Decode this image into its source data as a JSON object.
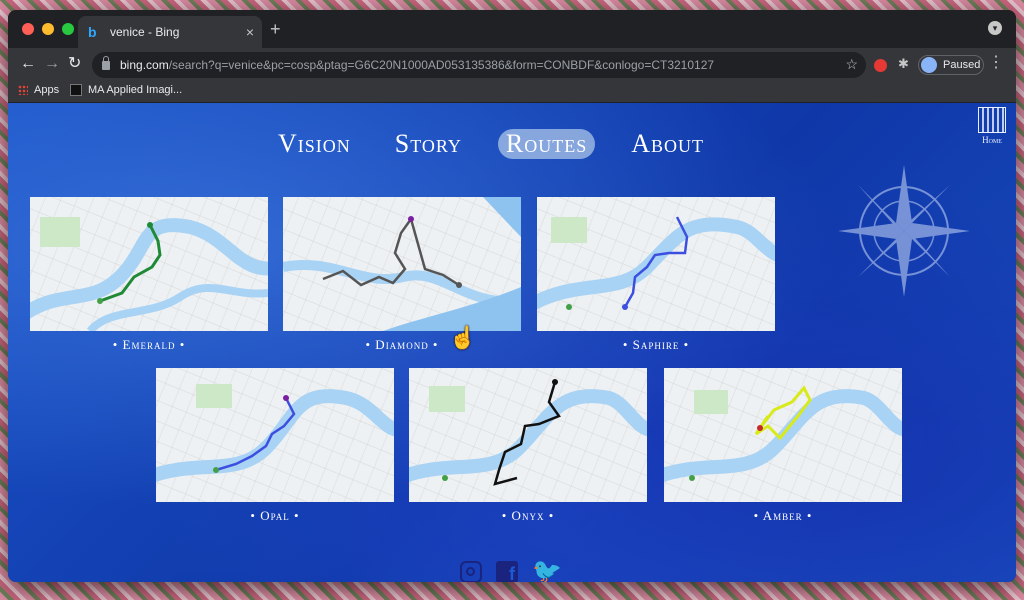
{
  "browser": {
    "tab_title": "venice - Bing",
    "new_tab": "+",
    "close": "×",
    "url_host": "bing.com",
    "url_rest": "/search?q=venice&pc=cosp&ptag=G6C20N1000AD053135386&form=CONBDF&conlogo=CT3210127",
    "profile": "Paused",
    "bookmarks": [
      "Apps",
      "MA Applied Imagi..."
    ]
  },
  "nav": {
    "items": [
      {
        "label": "Vision",
        "active": false
      },
      {
        "label": "Story",
        "active": false
      },
      {
        "label": "Routes",
        "active": true
      },
      {
        "label": "About",
        "active": false
      }
    ],
    "home": "Home"
  },
  "routes": [
    {
      "name": "• Emerald •",
      "color": "#1e8a36"
    },
    {
      "name": "• Diamond •",
      "color": "#555555"
    },
    {
      "name": "• Saphire •",
      "color": "#3c4fe0"
    },
    {
      "name": "• Opal •",
      "color": "#3c4fe0"
    },
    {
      "name": "• Onyx •",
      "color": "#111111"
    },
    {
      "name": "• Amber •",
      "color": "#d8ea1a"
    }
  ],
  "social": [
    "instagram-icon",
    "facebook-icon",
    "twitter-icon"
  ]
}
